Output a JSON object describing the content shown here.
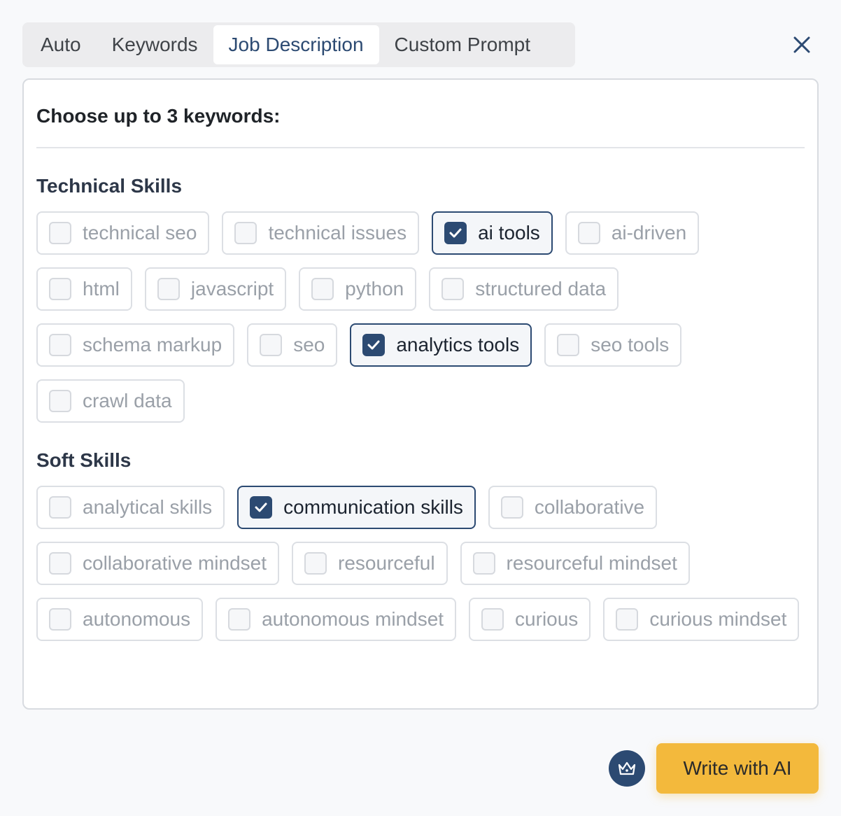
{
  "tabs": [
    {
      "label": "Auto",
      "active": false
    },
    {
      "label": "Keywords",
      "active": false
    },
    {
      "label": "Job Description",
      "active": true
    },
    {
      "label": "Custom Prompt",
      "active": false
    }
  ],
  "panel": {
    "title": "Choose up to 3 keywords:",
    "sections": [
      {
        "title": "Technical Skills",
        "keywords": [
          {
            "label": "technical seo",
            "checked": false
          },
          {
            "label": "technical issues",
            "checked": false
          },
          {
            "label": "ai tools",
            "checked": true
          },
          {
            "label": "ai-driven",
            "checked": false
          },
          {
            "label": "html",
            "checked": false
          },
          {
            "label": "javascript",
            "checked": false
          },
          {
            "label": "python",
            "checked": false
          },
          {
            "label": "structured data",
            "checked": false
          },
          {
            "label": "schema markup",
            "checked": false
          },
          {
            "label": "seo",
            "checked": false
          },
          {
            "label": "analytics tools",
            "checked": true
          },
          {
            "label": "seo tools",
            "checked": false
          },
          {
            "label": "crawl data",
            "checked": false
          }
        ]
      },
      {
        "title": "Soft Skills",
        "keywords": [
          {
            "label": "analytical skills",
            "checked": false
          },
          {
            "label": "communication skills",
            "checked": true
          },
          {
            "label": "collaborative",
            "checked": false
          },
          {
            "label": "collaborative mindset",
            "checked": false
          },
          {
            "label": "resourceful",
            "checked": false
          },
          {
            "label": "resourceful mindset",
            "checked": false
          },
          {
            "label": "autonomous",
            "checked": false
          },
          {
            "label": "autonomous mindset",
            "checked": false
          },
          {
            "label": "curious",
            "checked": false
          },
          {
            "label": "curious mindset",
            "checked": false
          }
        ]
      }
    ]
  },
  "actions": {
    "write_label": "Write with AI",
    "crown_icon": "crown-icon",
    "close_icon": "close-icon"
  },
  "colors": {
    "accent": "#2c4a72",
    "button": "#f3b93c"
  }
}
